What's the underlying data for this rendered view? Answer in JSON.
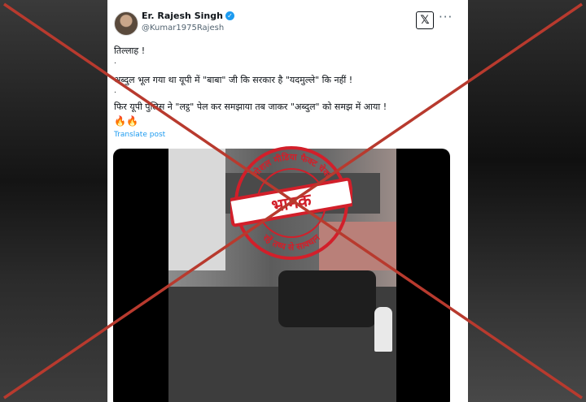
{
  "post": {
    "author_name": "Er. Rajesh Singh",
    "verified_badge": "✓",
    "handle": "@Kumar1975Rajesh",
    "x_icon": "𝕏",
    "more_icon": "···",
    "line1": "तिल्लाह !",
    "dot1": ".",
    "line2": "अब्दुल भूल गया था यूपी में \"बाबा\" जी कि सरकार है \"यदमुल्ले\" कि नहीं !",
    "dot2": ".",
    "line3": "फिर यूपी पुलिस ने \"लट्ठ\" पेल कर समझाया तब जाकर \"अब्दुल\" को समझ में आया !",
    "emoji": "🔥🔥",
    "translate": "Translate post"
  },
  "stamp": {
    "top_text": "सोशल मीडिया फैक्ट चेक",
    "label": "भ्रामक",
    "bottom_text": "रहें तथ्य से सावधान"
  },
  "colors": {
    "cross": "#b83a2e",
    "stamp": "#d21f2a",
    "link": "#1d9bf0"
  }
}
